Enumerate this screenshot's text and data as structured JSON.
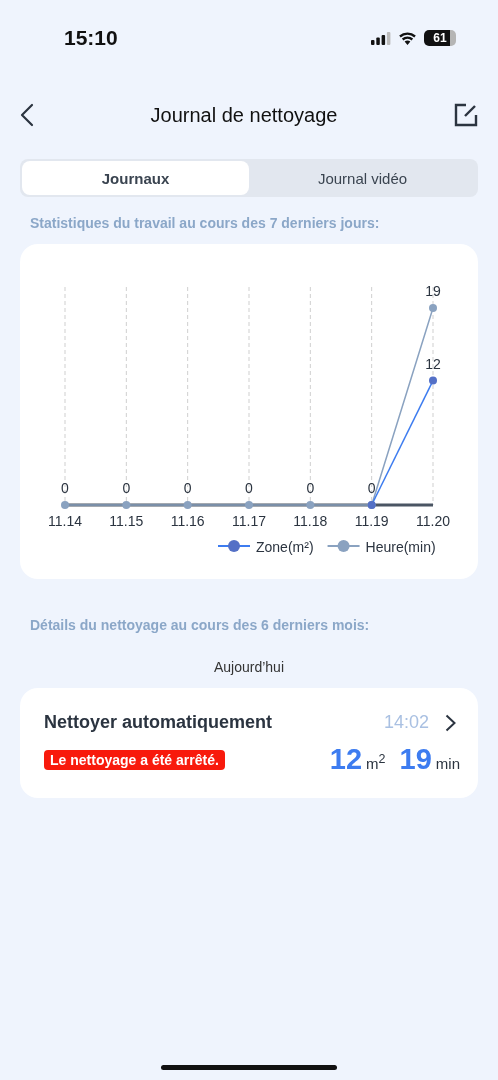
{
  "status_bar": {
    "time": "15:10",
    "battery": "61"
  },
  "header": {
    "title": "Journal de nettoyage"
  },
  "tabs": [
    {
      "label": "Journaux",
      "selected": true
    },
    {
      "label": "Journal vidéo",
      "selected": false
    }
  ],
  "stats_heading": "Statistiques du travail au cours des 7 derniers jours:",
  "chart_data": {
    "type": "line",
    "categories": [
      "11.14",
      "11.15",
      "11.16",
      "11.17",
      "11.18",
      "11.19",
      "11.20"
    ],
    "grid": true,
    "legend": "bottom",
    "series": [
      {
        "name": "Zone(m²)",
        "color": "#5470c6",
        "marker": "circle",
        "values": [
          null,
          null,
          null,
          null,
          null,
          0,
          12
        ],
        "value_labels": [
          null,
          null,
          null,
          null,
          null,
          null,
          "12"
        ]
      },
      {
        "name": "Heure(min)",
        "color": "#8aa2c0",
        "marker": "circle",
        "values": [
          0,
          0,
          0,
          0,
          0,
          0,
          19
        ],
        "value_labels": [
          "0",
          "0",
          "0",
          "0",
          "0",
          "0",
          "19"
        ]
      }
    ]
  },
  "details_heading": "Détails du nettoyage au cours des 6 derniers mois:",
  "day_label": "Aujourd’hui",
  "records": [
    {
      "title": "Nettoyer automatiquement",
      "time": "14:02",
      "status": "Le nettoyage a été arrêté.",
      "area": "12",
      "area_unit": "m$^{2}$",
      "duration": "19",
      "duration_unit": "min"
    }
  ]
}
